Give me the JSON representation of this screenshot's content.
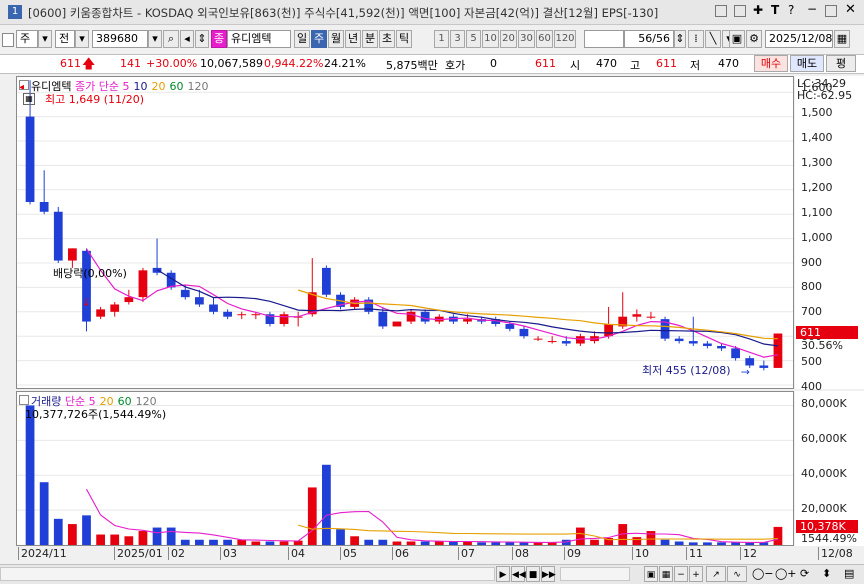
{
  "window": {
    "number": "1",
    "title": "[0600] 키움종합차트 - KOSDAQ 외국인보유[863(천)] 주식수[41,592(천)] 액면[100] 자본금[42(억)] 결산[12월] EPS[-130]",
    "icons": [
      "link-icon",
      "restore-icon",
      "pin-icon",
      "text-icon",
      "help-icon",
      "minimize-icon",
      "maximize-icon",
      "close-icon"
    ]
  },
  "toolbar": {
    "period_type": "주",
    "compare_label": "전",
    "code": "389680",
    "name_badge": "종",
    "name": "유디엠텍",
    "periods": [
      "일",
      "주",
      "월",
      "년",
      "분",
      "초",
      "틱"
    ],
    "selected_period": "주",
    "intervals": [
      "1",
      "3",
      "5",
      "10",
      "20",
      "30",
      "60",
      "120"
    ],
    "range": "56/56",
    "date": "2025/12/08"
  },
  "quote": {
    "price": "611",
    "change": "141",
    "change_pct": "+30.00%",
    "volume": "10,067,589",
    "volume_ratio": "0,944.22%",
    "turnover": "24.21%",
    "amount": "5,875백만",
    "hoga_label": "호가",
    "hoga_value": "0",
    "hoga_price": "611",
    "open_label": "시",
    "open": "470",
    "high_label": "고",
    "high": "611",
    "low_label": "저",
    "low": "470",
    "buy": "매수",
    "sell": "매도",
    "eval": "평"
  },
  "price_legend": {
    "name": "유디엠텍",
    "ma_label": "종가 단순",
    "ma": [
      "5",
      "10",
      "20",
      "60",
      "120"
    ],
    "ma_colors": [
      "#e61ecc",
      "#1a1a8c",
      "#e6a000",
      "#008c2c",
      "#7a7a7a"
    ],
    "high_note": "최고 1,649 (11/20)",
    "low_note": "최저 455 (12/08)",
    "event_note": "배당락(0,00%)",
    "lc": "LC:34.29",
    "hc": "HC:-62.95",
    "last_price_tag": "611",
    "last_pct_tag": "30.56%"
  },
  "volume_legend": {
    "label": "거래량",
    "ma_label": "단순",
    "ma": [
      "5",
      "20",
      "60",
      "120"
    ],
    "ma_colors": [
      "#e61ecc",
      "#e6a000",
      "#008c2c",
      "#7a7a7a"
    ],
    "max_note": "10,377,726주(1,544.49%)",
    "last_vol_tag": "10,378K",
    "last_pct_tag": "1544.49%"
  },
  "price_axis": [
    "1,600",
    "1,500",
    "1,400",
    "1,300",
    "1,200",
    "1,100",
    "1,000",
    "900",
    "800",
    "700",
    "600",
    "500",
    "400"
  ],
  "volume_axis": [
    "80,000K",
    "60,000K",
    "40,000K",
    "20,000K"
  ],
  "date_axis": [
    "2024/11",
    "2025/01",
    "02",
    "03",
    "04",
    "05",
    "06",
    "07",
    "08",
    "09",
    "10",
    "11",
    "12",
    "12/08"
  ],
  "chart_data": {
    "type": "candlestick",
    "ylim": [
      400,
      1650
    ],
    "candles": [
      {
        "o": 1500,
        "h": 1649,
        "l": 1140,
        "c": 1150
      },
      {
        "o": 1150,
        "h": 1280,
        "l": 1100,
        "c": 1110
      },
      {
        "o": 1110,
        "h": 1130,
        "l": 900,
        "c": 910
      },
      {
        "o": 910,
        "h": 960,
        "l": 880,
        "c": 960
      },
      {
        "o": 950,
        "h": 960,
        "l": 620,
        "c": 660
      },
      {
        "o": 680,
        "h": 720,
        "l": 670,
        "c": 710
      },
      {
        "o": 700,
        "h": 740,
        "l": 680,
        "c": 730
      },
      {
        "o": 740,
        "h": 790,
        "l": 730,
        "c": 760
      },
      {
        "o": 760,
        "h": 880,
        "l": 740,
        "c": 870
      },
      {
        "o": 880,
        "h": 1000,
        "l": 850,
        "c": 860
      },
      {
        "o": 860,
        "h": 870,
        "l": 790,
        "c": 800
      },
      {
        "o": 790,
        "h": 810,
        "l": 750,
        "c": 760
      },
      {
        "o": 760,
        "h": 790,
        "l": 720,
        "c": 730
      },
      {
        "o": 730,
        "h": 760,
        "l": 690,
        "c": 700
      },
      {
        "o": 700,
        "h": 710,
        "l": 670,
        "c": 680
      },
      {
        "o": 690,
        "h": 700,
        "l": 670,
        "c": 690
      },
      {
        "o": 690,
        "h": 700,
        "l": 670,
        "c": 690
      },
      {
        "o": 690,
        "h": 700,
        "l": 640,
        "c": 650
      },
      {
        "o": 650,
        "h": 700,
        "l": 640,
        "c": 690
      },
      {
        "o": 680,
        "h": 700,
        "l": 640,
        "c": 680
      },
      {
        "o": 690,
        "h": 920,
        "l": 680,
        "c": 780
      },
      {
        "o": 880,
        "h": 890,
        "l": 760,
        "c": 770
      },
      {
        "o": 770,
        "h": 780,
        "l": 710,
        "c": 720
      },
      {
        "o": 720,
        "h": 760,
        "l": 710,
        "c": 750
      },
      {
        "o": 750,
        "h": 760,
        "l": 690,
        "c": 700
      },
      {
        "o": 700,
        "h": 720,
        "l": 630,
        "c": 640
      },
      {
        "o": 640,
        "h": 660,
        "l": 640,
        "c": 660
      },
      {
        "o": 660,
        "h": 710,
        "l": 650,
        "c": 700
      },
      {
        "o": 700,
        "h": 710,
        "l": 650,
        "c": 660
      },
      {
        "o": 660,
        "h": 690,
        "l": 650,
        "c": 680
      },
      {
        "o": 680,
        "h": 690,
        "l": 650,
        "c": 660
      },
      {
        "o": 660,
        "h": 690,
        "l": 650,
        "c": 670
      },
      {
        "o": 670,
        "h": 680,
        "l": 650,
        "c": 660
      },
      {
        "o": 670,
        "h": 680,
        "l": 640,
        "c": 650
      },
      {
        "o": 650,
        "h": 660,
        "l": 620,
        "c": 630
      },
      {
        "o": 630,
        "h": 640,
        "l": 590,
        "c": 600
      },
      {
        "o": 590,
        "h": 600,
        "l": 580,
        "c": 590
      },
      {
        "o": 580,
        "h": 600,
        "l": 570,
        "c": 580
      },
      {
        "o": 580,
        "h": 600,
        "l": 560,
        "c": 570
      },
      {
        "o": 570,
        "h": 610,
        "l": 560,
        "c": 600
      },
      {
        "o": 580,
        "h": 620,
        "l": 570,
        "c": 600
      },
      {
        "o": 600,
        "h": 720,
        "l": 590,
        "c": 650
      },
      {
        "o": 640,
        "h": 780,
        "l": 630,
        "c": 680
      },
      {
        "o": 680,
        "h": 710,
        "l": 660,
        "c": 690
      },
      {
        "o": 680,
        "h": 700,
        "l": 670,
        "c": 680
      },
      {
        "o": 670,
        "h": 680,
        "l": 580,
        "c": 590
      },
      {
        "o": 590,
        "h": 600,
        "l": 570,
        "c": 580
      },
      {
        "o": 580,
        "h": 680,
        "l": 560,
        "c": 570
      },
      {
        "o": 570,
        "h": 580,
        "l": 550,
        "c": 560
      },
      {
        "o": 560,
        "h": 570,
        "l": 540,
        "c": 550
      },
      {
        "o": 550,
        "h": 560,
        "l": 500,
        "c": 510
      },
      {
        "o": 510,
        "h": 520,
        "l": 470,
        "c": 480
      },
      {
        "o": 480,
        "h": 500,
        "l": 460,
        "c": 470
      },
      {
        "o": 470,
        "h": 611,
        "l": 470,
        "c": 611
      }
    ],
    "volume_k": [
      80000,
      36000,
      15000,
      12000,
      17000,
      6000,
      6000,
      5000,
      8000,
      10000,
      10000,
      3000,
      3000,
      3000,
      3000,
      3000,
      2000,
      2000,
      2000,
      2500,
      33000,
      46000,
      9000,
      5000,
      3000,
      3000,
      2000,
      2000,
      2000,
      2000,
      2000,
      2000,
      1500,
      1500,
      1500,
      1500,
      1500,
      1500,
      3000,
      10000,
      3000,
      4000,
      12000,
      4500,
      8000,
      3000,
      2000,
      1500,
      1500,
      1500,
      1500,
      1500,
      1500,
      10378
    ]
  }
}
